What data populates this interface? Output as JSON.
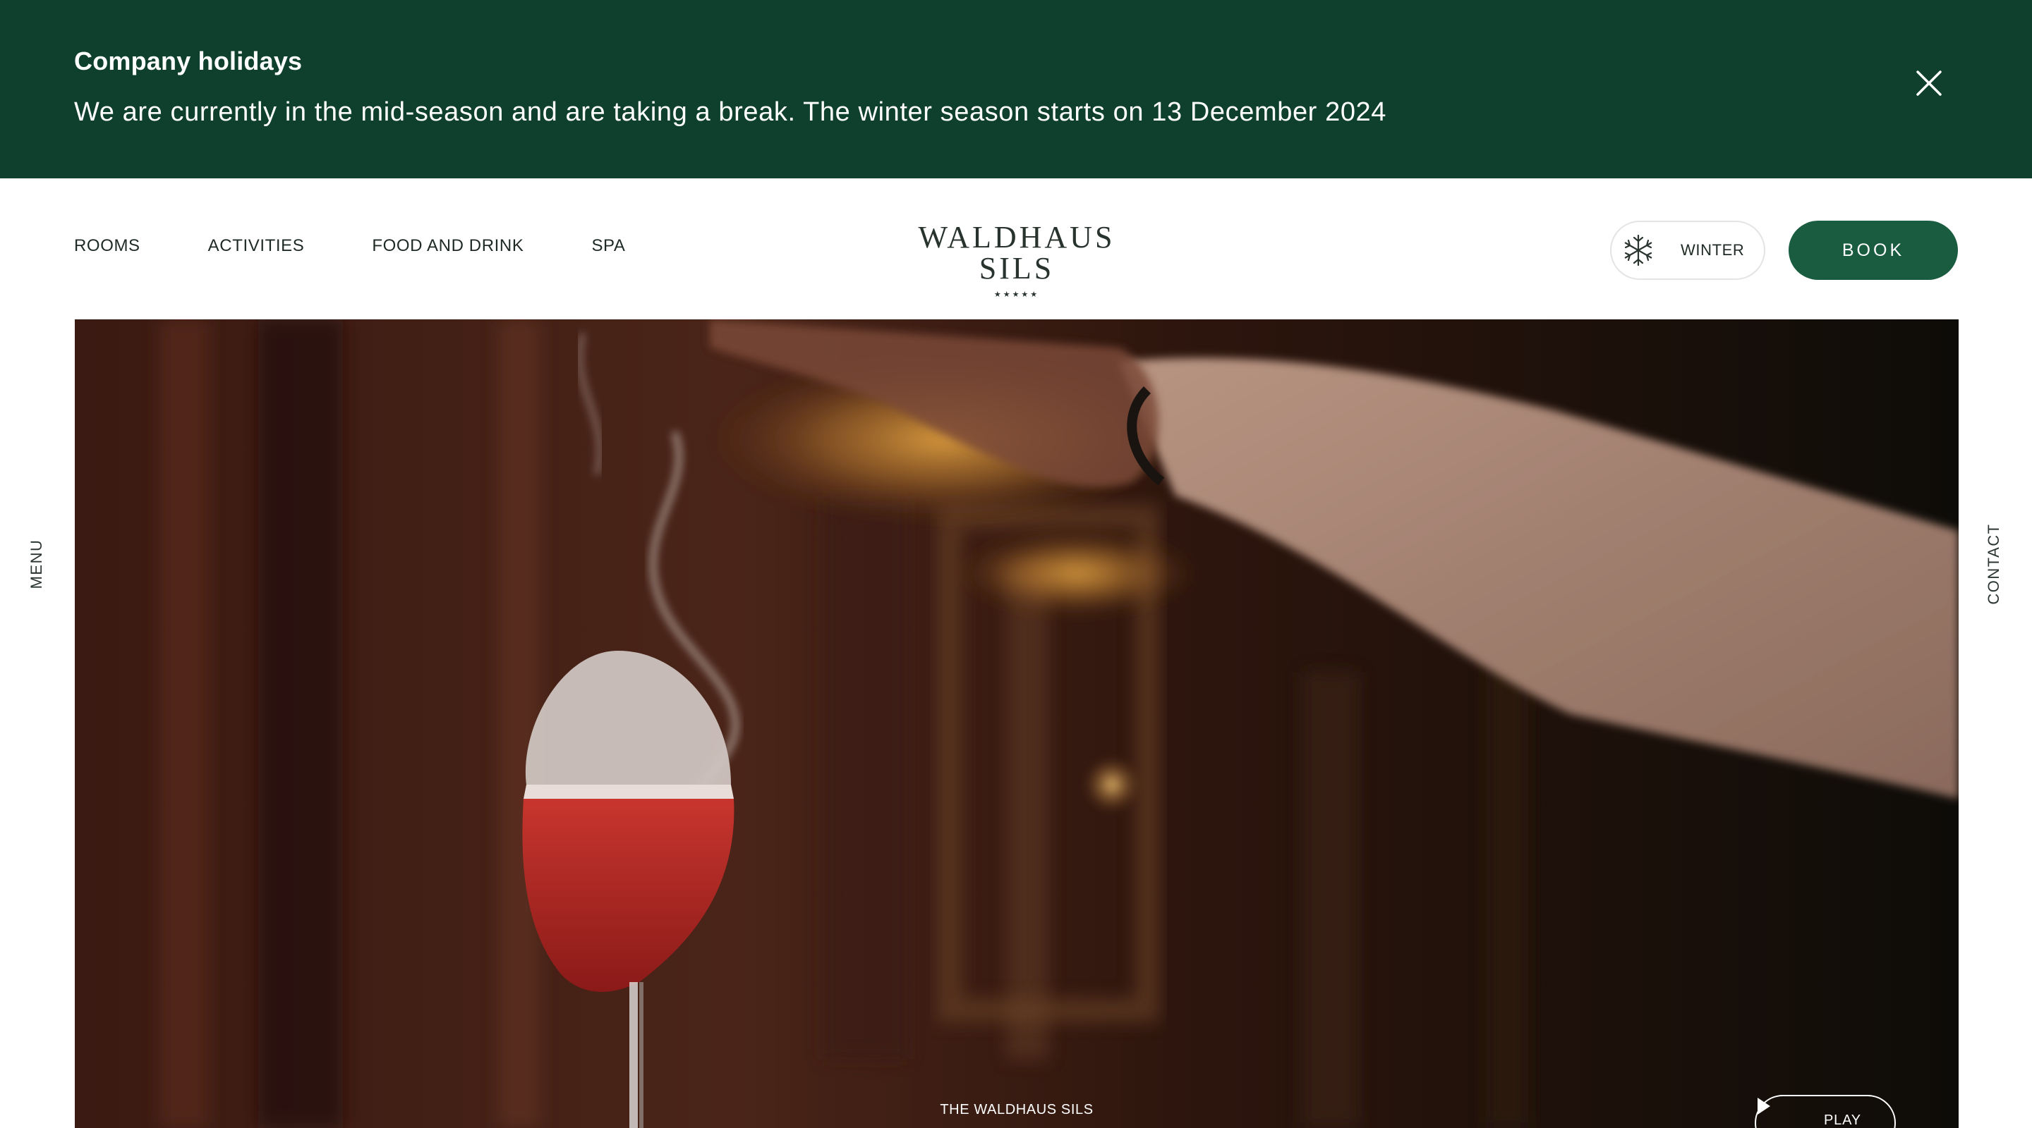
{
  "notice": {
    "title": "Company holidays",
    "text": "We are currently in the mid-season and are taking a break. The winter season starts on 13 December 2024",
    "close_icon": "close-icon"
  },
  "nav": {
    "items": [
      {
        "label": "ROOMS"
      },
      {
        "label": "ACTIVITIES"
      },
      {
        "label": "FOOD AND DRINK"
      },
      {
        "label": "SPA"
      }
    ]
  },
  "logo": {
    "text": "WALDHAUS SILS",
    "stars": "★★★★★"
  },
  "season": {
    "label": "WINTER",
    "icon": "snowflake-icon"
  },
  "book": {
    "label": "BOOK"
  },
  "side": {
    "menu_label": "MENU",
    "contact_label": "CONTACT"
  },
  "hero": {
    "caption": "THE WALDHAUS SILS",
    "play_label": "PLAY",
    "play_icon": "play-icon"
  },
  "colors": {
    "banner_bg": "#0f402d",
    "brand_green": "#1a5c40",
    "text_dark": "#1f2a24"
  }
}
